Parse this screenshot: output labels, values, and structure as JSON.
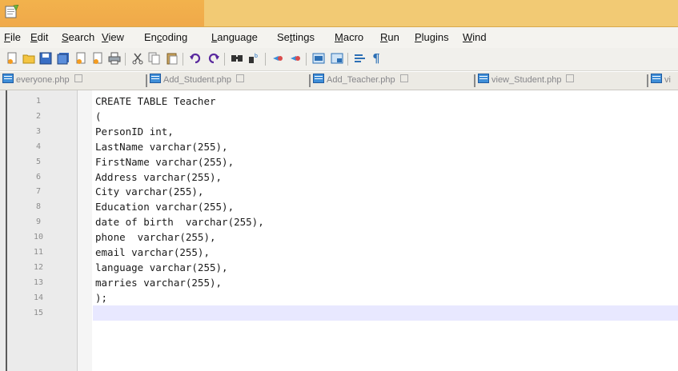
{
  "menu": [
    "File",
    "Edit",
    "Search",
    "View",
    "Encoding",
    "Language",
    "Settings",
    "Macro",
    "Run",
    "Plugins",
    "Wind"
  ],
  "menu_mnemonic": [
    "F",
    "E",
    "S",
    "V",
    "c",
    "L",
    "t",
    "M",
    "R",
    "P",
    "W"
  ],
  "toolbar_icons": [
    "new-file-icon",
    "open-file-icon",
    "save-icon",
    "save-all-icon",
    "close-icon",
    "close-all-icon",
    "print-icon",
    "cut-icon",
    "copy-icon",
    "paste-icon",
    "undo-icon",
    "redo-icon",
    "find-icon",
    "replace-icon",
    "zoom-in-icon",
    "zoom-out-icon",
    "sync-vertical-icon",
    "sync-horizontal-icon",
    "word-wrap-icon",
    "show-all-chars-icon"
  ],
  "tabs": [
    {
      "label": "everyone.php"
    },
    {
      "label": "Add_Student.php"
    },
    {
      "label": "Add_Teacher.php"
    },
    {
      "label": "view_Student.php"
    },
    {
      "label": "vi"
    }
  ],
  "editor": {
    "lines": [
      {
        "num": "1",
        "text": "CREATE TABLE Teacher"
      },
      {
        "num": "2",
        "text": "("
      },
      {
        "num": "3",
        "text": "PersonID int,"
      },
      {
        "num": "4",
        "text": "LastName varchar(255),"
      },
      {
        "num": "5",
        "text": "FirstName varchar(255),"
      },
      {
        "num": "6",
        "text": "Address varchar(255),"
      },
      {
        "num": "7",
        "text": "City varchar(255),"
      },
      {
        "num": "8",
        "text": "Education varchar(255),"
      },
      {
        "num": "9",
        "text": "date of birth  varchar(255),"
      },
      {
        "num": "10",
        "text": "phone  varchar(255),"
      },
      {
        "num": "11",
        "text": "email varchar(255),"
      },
      {
        "num": "12",
        "text": "language varchar(255),"
      },
      {
        "num": "13",
        "text": "marries varchar(255),"
      },
      {
        "num": "14",
        "text": ");"
      },
      {
        "num": "15",
        "text": ""
      }
    ],
    "current_line": 15
  },
  "colors": {
    "titlebar": "#f2ca74",
    "tab_icon": "#3f8ed8",
    "current_line": "#e8e8ff",
    "gutter": "#ebebeb"
  }
}
